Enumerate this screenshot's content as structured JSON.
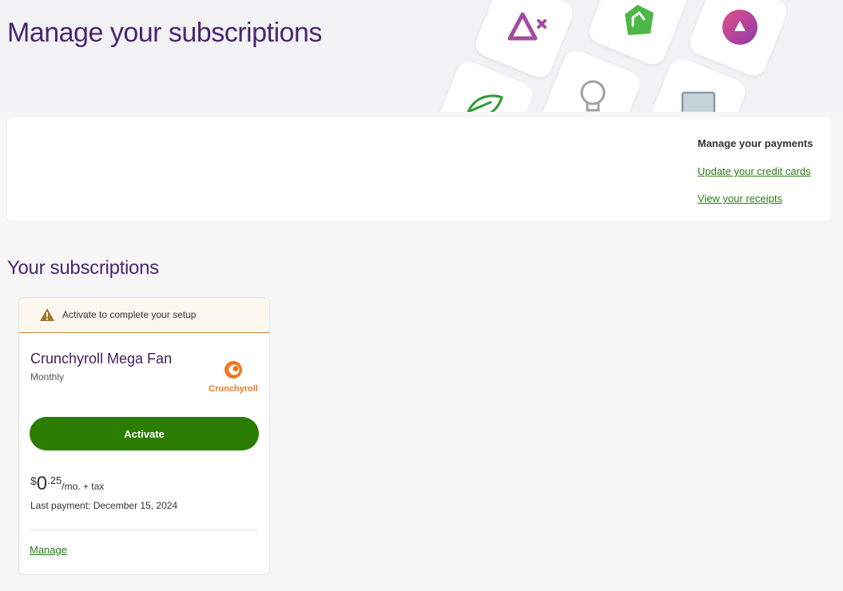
{
  "page": {
    "title": "Manage your subscriptions"
  },
  "hero_icons": [
    "triangle-x-icon",
    "house-arrow-icon",
    "triangle-circle-icon",
    "leaf-icon",
    "lightbulb-icon",
    "tablet-icon"
  ],
  "payments": {
    "heading": "Manage your payments",
    "update_cards_link": "Update your credit cards",
    "receipts_link": "View your receipts"
  },
  "subscriptions": {
    "section_title": "Your subscriptions",
    "items": [
      {
        "alert_text": "Activate to complete your setup",
        "name": "Crunchyroll Mega Fan",
        "period": "Monthly",
        "logo_text": "Crunchyroll",
        "activate_label": "Activate",
        "price_currency": "$",
        "price_whole": "0",
        "price_cents": ".25",
        "price_unit": "/mo. + tax",
        "last_payment": "Last payment: December 15, 2024",
        "manage_label": "Manage"
      }
    ]
  },
  "colors": {
    "brand_purple": "#4a2670",
    "action_green": "#2a7d01",
    "link_green": "#2a7d11",
    "alert_bg": "#fdf8ef",
    "alert_border": "#c08a2c",
    "crunchyroll_orange": "#f47521"
  }
}
